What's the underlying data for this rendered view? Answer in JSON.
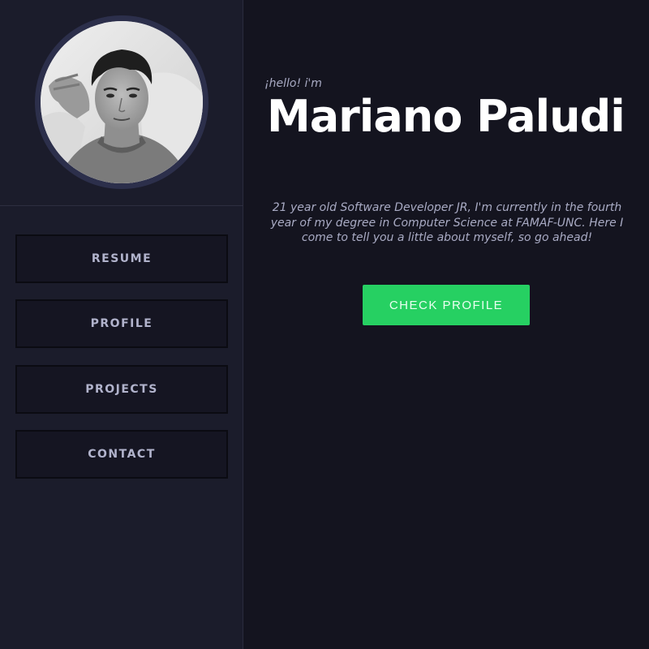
{
  "sidebar": {
    "avatar_alt": "Profile photo",
    "nav": [
      {
        "label": "RESUME"
      },
      {
        "label": "PROFILE"
      },
      {
        "label": "PROJECTS"
      },
      {
        "label": "CONTACT"
      }
    ]
  },
  "hero": {
    "greeting": "¡hello! i'm",
    "name": "Mariano Paludi",
    "bio": "21 year old Software Developer JR, I'm currently in the fourth year of my degree in Computer Science at FAMAF-UNC. Here I come to tell you a little about myself, so go ahead!",
    "cta_label": "CHECK PROFILE"
  },
  "colors": {
    "sidebar_bg": "#1b1c2b",
    "main_bg": "#14141f",
    "accent": "#26d062",
    "text_muted": "#a9abc4"
  }
}
